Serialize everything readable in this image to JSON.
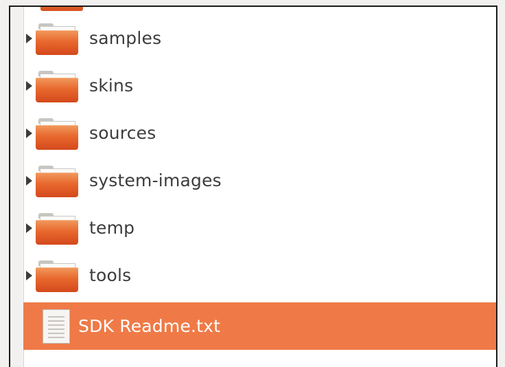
{
  "file_list": {
    "items": [
      {
        "name": "samples",
        "type": "folder",
        "icon": "folder-icon",
        "expandable": true
      },
      {
        "name": "skins",
        "type": "folder",
        "icon": "folder-icon",
        "expandable": true
      },
      {
        "name": "sources",
        "type": "folder",
        "icon": "folder-icon",
        "expandable": true
      },
      {
        "name": "system-images",
        "type": "folder",
        "icon": "folder-icon",
        "expandable": true
      },
      {
        "name": "temp",
        "type": "folder",
        "icon": "folder-icon",
        "expandable": true
      },
      {
        "name": "tools",
        "type": "folder",
        "icon": "folder-icon",
        "expandable": true
      },
      {
        "name": "SDK Readme.txt",
        "type": "file",
        "icon": "text-file-icon",
        "expandable": false,
        "selected": true
      }
    ]
  },
  "colors": {
    "selection": "#ef7a47",
    "folder": "#e8692e",
    "text": "#3c3c3c",
    "selected_text": "#ffffff"
  }
}
